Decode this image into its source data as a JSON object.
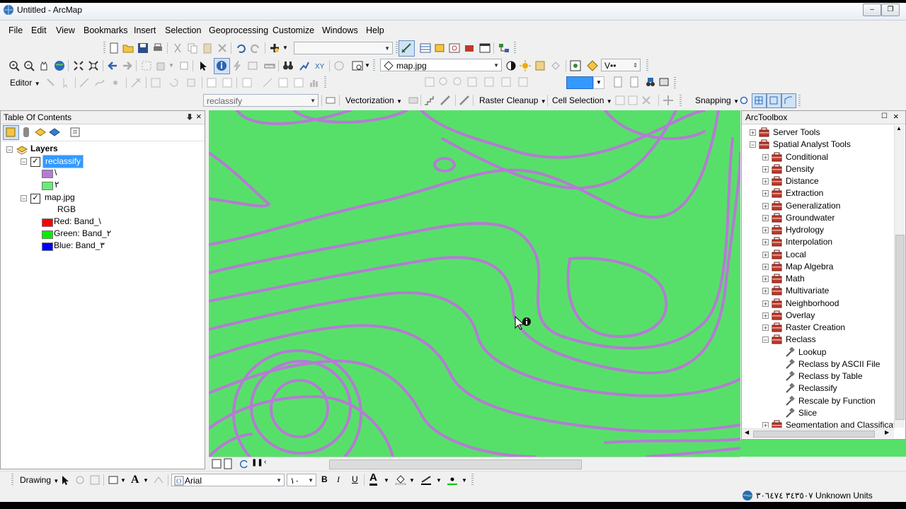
{
  "window": {
    "title": "Untitled - ArcMap"
  },
  "menu": [
    "File",
    "Edit",
    "View",
    "Bookmarks",
    "Insert",
    "Selection",
    "Geoprocessing",
    "Customize",
    "Windows",
    "Help"
  ],
  "toolbar": {
    "layer_combo": "map.jpg",
    "scale_combo": "V••",
    "editor_label": "Editor",
    "editor_layer": "reclassify",
    "vectorization": "Vectorization",
    "raster_cleanup": "Raster Cleanup",
    "cell_selection": "Cell Selection",
    "snapping": "Snapping"
  },
  "toc": {
    "title": "Table Of Contents",
    "root": "Layers",
    "layers": [
      {
        "name": "reclassify",
        "checked": true,
        "classes": [
          {
            "label": "\\",
            "color": "#b57bd4"
          },
          {
            "label": "٢",
            "color": "#66ee77"
          }
        ]
      },
      {
        "name": "map.jpg",
        "checked": true,
        "composite": "RGB",
        "bands": [
          {
            "label": "Red:   Band_\\",
            "color": "#ff0000"
          },
          {
            "label": "Green: Band_٢",
            "color": "#00ee00"
          },
          {
            "label": "Blue:  Band_٣",
            "color": "#0000ff"
          }
        ]
      }
    ]
  },
  "toolbox": {
    "title": "ArcToolbox",
    "items": [
      {
        "label": "Server Tools",
        "level": 0,
        "state": "+"
      },
      {
        "label": "Spatial Analyst Tools",
        "level": 0,
        "state": "-"
      },
      {
        "label": "Conditional",
        "level": 1,
        "state": "+"
      },
      {
        "label": "Density",
        "level": 1,
        "state": "+"
      },
      {
        "label": "Distance",
        "level": 1,
        "state": "+"
      },
      {
        "label": "Extraction",
        "level": 1,
        "state": "+"
      },
      {
        "label": "Generalization",
        "level": 1,
        "state": "+"
      },
      {
        "label": "Groundwater",
        "level": 1,
        "state": "+"
      },
      {
        "label": "Hydrology",
        "level": 1,
        "state": "+"
      },
      {
        "label": "Interpolation",
        "level": 1,
        "state": "+"
      },
      {
        "label": "Local",
        "level": 1,
        "state": "+"
      },
      {
        "label": "Map Algebra",
        "level": 1,
        "state": "+"
      },
      {
        "label": "Math",
        "level": 1,
        "state": "+"
      },
      {
        "label": "Multivariate",
        "level": 1,
        "state": "+"
      },
      {
        "label": "Neighborhood",
        "level": 1,
        "state": "+"
      },
      {
        "label": "Overlay",
        "level": 1,
        "state": "+"
      },
      {
        "label": "Raster Creation",
        "level": 1,
        "state": "+"
      },
      {
        "label": "Reclass",
        "level": 1,
        "state": "-"
      },
      {
        "label": "Lookup",
        "level": 2,
        "state": ""
      },
      {
        "label": "Reclass by ASCII File",
        "level": 2,
        "state": ""
      },
      {
        "label": "Reclass by Table",
        "level": 2,
        "state": ""
      },
      {
        "label": "Reclassify",
        "level": 2,
        "state": ""
      },
      {
        "label": "Rescale by Function",
        "level": 2,
        "state": ""
      },
      {
        "label": "Slice",
        "level": 2,
        "state": ""
      },
      {
        "label": "Segmentation and Classificat",
        "level": 1,
        "state": "+"
      }
    ]
  },
  "drawing": {
    "label": "Drawing",
    "font": "Arial",
    "size": "١٠"
  },
  "status": {
    "coords": "٣٤٣٥٠٧  ٣٠٦٤٧٤  Unknown Units"
  },
  "colors": {
    "map_fill": "#57e069",
    "contour": "#b57bd4",
    "selection": "#3399ff"
  }
}
